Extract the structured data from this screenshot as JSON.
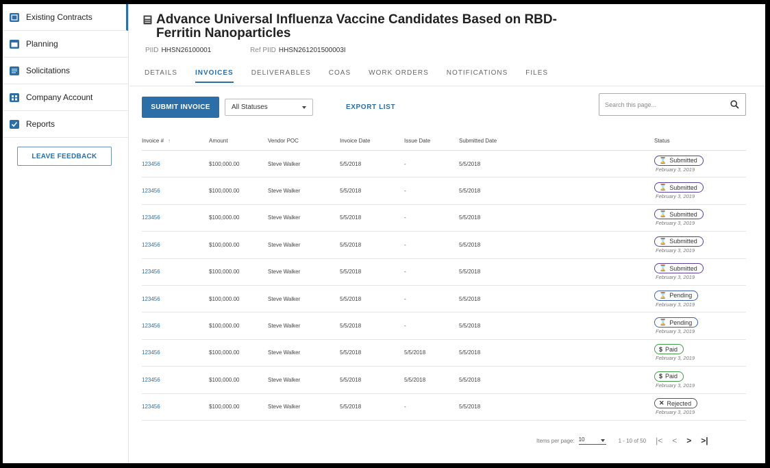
{
  "sidebar": {
    "items": [
      {
        "label": "Existing Contracts"
      },
      {
        "label": "Planning"
      },
      {
        "label": "Solicitations"
      },
      {
        "label": "Company Account"
      },
      {
        "label": "Reports"
      }
    ],
    "feedback_label": "LEAVE FEEDBACK"
  },
  "header": {
    "title": "Advance Universal Influenza Vaccine Candidates Based on RBD-Ferritin Nanoparticles",
    "piid_label": "PIID",
    "piid": "HHSN26100001",
    "ref_piid_label": "Ref PIID",
    "ref_piid": "HHSN261201500003I"
  },
  "tabs": [
    {
      "label": "DETAILS"
    },
    {
      "label": "INVOICES"
    },
    {
      "label": "DELIVERABLES"
    },
    {
      "label": "COAS"
    },
    {
      "label": "WORK ORDERS"
    },
    {
      "label": "NOTIFICATIONS"
    },
    {
      "label": "FILES"
    }
  ],
  "toolbar": {
    "submit_label": "SUBMIT INVOICE",
    "status_filter": "All Statuses",
    "export_label": "EXPORT LIST",
    "search_placeholder": "Search this page..."
  },
  "table": {
    "columns": [
      "Invoice #",
      "Amount",
      "Vendor POC",
      "Invoice Date",
      "Issue Date",
      "Submitted Date",
      "Status"
    ],
    "sort_indicator": "↑",
    "rows": [
      {
        "invoice": "123456",
        "amount": "$100,000.00",
        "vendor": "Steve Walker",
        "invoice_date": "5/5/2018",
        "issue_date": "-",
        "submitted": "5/5/2018",
        "status": "Submitted",
        "status_symbol": "⌛",
        "status_date": "February 3, 2019"
      },
      {
        "invoice": "123456",
        "amount": "$100,000.00",
        "vendor": "Steve Walker",
        "invoice_date": "5/5/2018",
        "issue_date": "-",
        "submitted": "5/5/2018",
        "status": "Submitted",
        "status_symbol": "⌛",
        "status_date": "February 3, 2019"
      },
      {
        "invoice": "123456",
        "amount": "$100,000.00",
        "vendor": "Steve Walker",
        "invoice_date": "5/5/2018",
        "issue_date": "-",
        "submitted": "5/5/2018",
        "status": "Submitted",
        "status_symbol": "⌛",
        "status_date": "February 3, 2019"
      },
      {
        "invoice": "123456",
        "amount": "$100,000.00",
        "vendor": "Steve Walker",
        "invoice_date": "5/5/2018",
        "issue_date": "-",
        "submitted": "5/5/2018",
        "status": "Submitted",
        "status_symbol": "⌛",
        "status_date": "February 3, 2019"
      },
      {
        "invoice": "123456",
        "amount": "$100,000.00",
        "vendor": "Steve Walker",
        "invoice_date": "5/5/2018",
        "issue_date": "-",
        "submitted": "5/5/2018",
        "status": "Submitted",
        "status_symbol": "⌛",
        "status_date": "February 3, 2019"
      },
      {
        "invoice": "123456",
        "amount": "$100,000.00",
        "vendor": "Steve Walker",
        "invoice_date": "5/5/2018",
        "issue_date": "-",
        "submitted": "5/5/2018",
        "status": "Pending",
        "status_symbol": "⌛",
        "status_date": "February 3, 2019"
      },
      {
        "invoice": "123456",
        "amount": "$100,000.00",
        "vendor": "Steve Walker",
        "invoice_date": "5/5/2018",
        "issue_date": "-",
        "submitted": "5/5/2018",
        "status": "Pending",
        "status_symbol": "⌛",
        "status_date": "February 3, 2019"
      },
      {
        "invoice": "123456",
        "amount": "$100,000.00",
        "vendor": "Steve Walker",
        "invoice_date": "5/5/2018",
        "issue_date": "5/5/2018",
        "submitted": "5/5/2018",
        "status": "Paid",
        "status_symbol": "$",
        "status_date": "February 3, 2019"
      },
      {
        "invoice": "123456",
        "amount": "$100,000.00",
        "vendor": "Steve Walker",
        "invoice_date": "5/5/2018",
        "issue_date": "5/5/2018",
        "submitted": "5/5/2018",
        "status": "Paid",
        "status_symbol": "$",
        "status_date": "February 3, 2019"
      },
      {
        "invoice": "123456",
        "amount": "$100,000.00",
        "vendor": "Steve Walker",
        "invoice_date": "5/5/2018",
        "issue_date": "-",
        "submitted": "5/5/2018",
        "status": "Rejected",
        "status_symbol": "✕",
        "status_date": "February 3, 2019"
      }
    ]
  },
  "pagination": {
    "items_per_page_label": "Items per page:",
    "items_per_page": "10",
    "range": "1 - 10 of 50",
    "first": "|<",
    "prev": "<",
    "next": ">",
    "last": ">|"
  },
  "colors": {
    "accent": "#2b6ea8",
    "submitted": "#5a3ea0",
    "pending": "#3d5fa8",
    "paid": "#3f9a47",
    "rejected": "#555555"
  }
}
